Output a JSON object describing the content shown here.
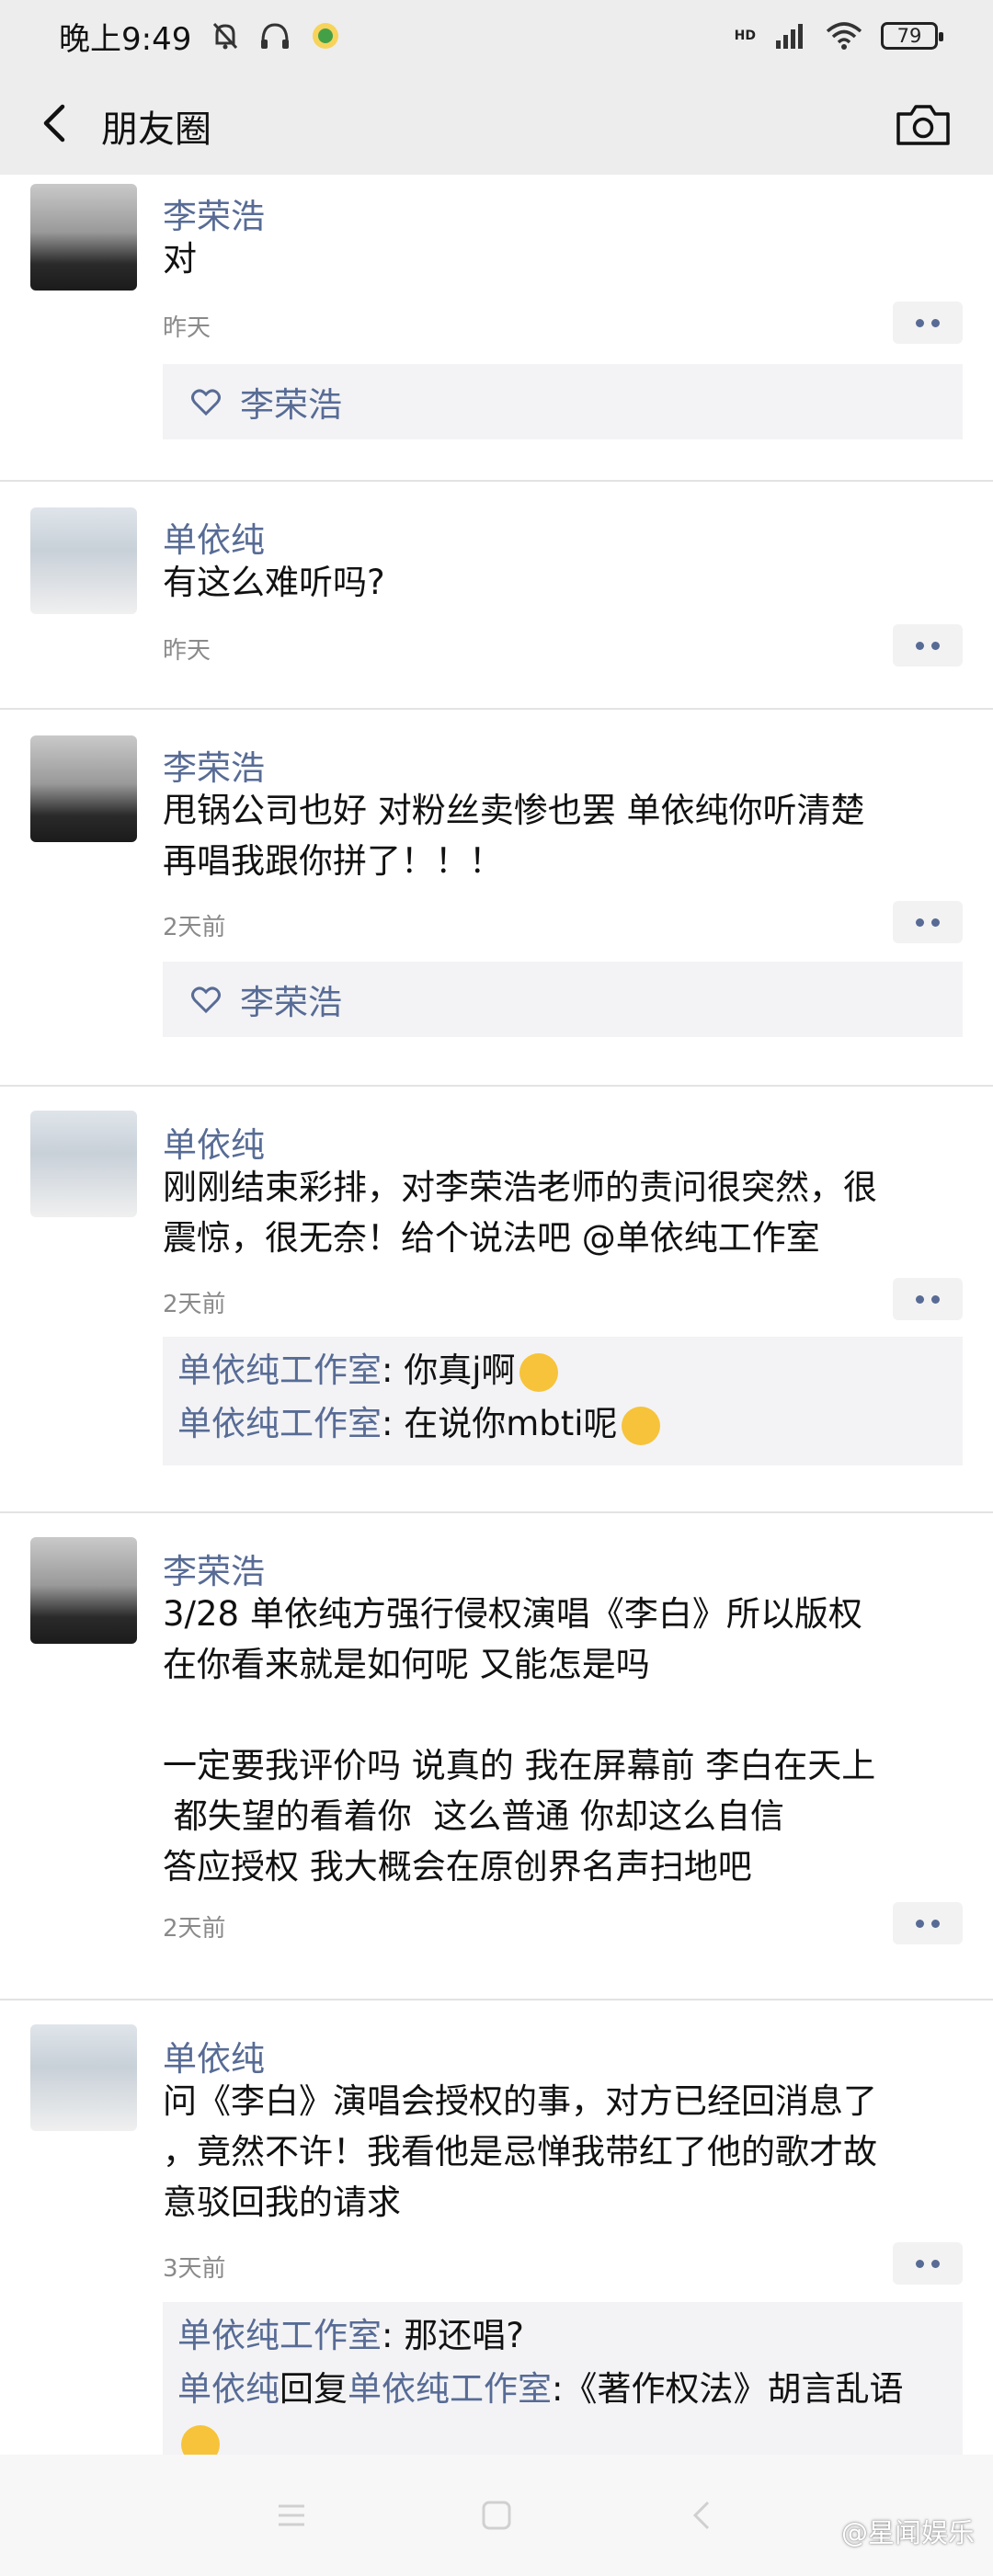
{
  "status_bar": {
    "time": "晚上9:49",
    "hd": "HD",
    "battery": "79"
  },
  "nav": {
    "title": "朋友圈"
  },
  "posts": [
    {
      "name": "李荣浩",
      "text": "对",
      "time": "昨天",
      "likes": [
        "李荣浩"
      ]
    },
    {
      "name": "单依纯",
      "text": "有这么难听吗?",
      "time": "昨天"
    },
    {
      "name": "李荣浩",
      "text": "甩锅公司也好 对粉丝卖惨也罢 单依纯你听清楚\n再唱我跟你拼了！！！",
      "time": "2天前",
      "likes": [
        "李荣浩"
      ]
    },
    {
      "name": "单依纯",
      "text": "刚刚结束彩排，对李荣浩老师的责问很突然，很\n震惊，很无奈！给个说法吧 @单依纯工作室",
      "time": "2天前",
      "comments": [
        {
          "author": "单依纯工作室",
          "text": ": 你真j啊"
        },
        {
          "author": "单依纯工作室",
          "text": ": 在说你mbti呢"
        }
      ]
    },
    {
      "name": "李荣浩",
      "text": "3/28 单依纯方强行侵权演唱《李白》所以版权\n在你看来就是如何呢 又能怎是吗\n\n一定要我评价吗 说真的 我在屏幕前 李白在天上\n 都失望的看着你  这么普通 你却这么自信\n答应授权 我大概会在原创界名声扫地吧",
      "time": "2天前"
    },
    {
      "name": "单依纯",
      "text": "问《李白》演唱会授权的事，对方已经回消息了\n，竟然不许！我看他是忌惮我带红了他的歌才故\n意驳回我的请求",
      "time": "3天前",
      "comments": [
        {
          "author": "单依纯工作室",
          "text": ": 那还唱?"
        },
        {
          "author": "单依纯",
          "reply_word": "回复",
          "reply_to": "单依纯工作室",
          "text": ":《著作权法》胡言乱语"
        }
      ]
    }
  ],
  "watermark": "@星闻娱乐"
}
